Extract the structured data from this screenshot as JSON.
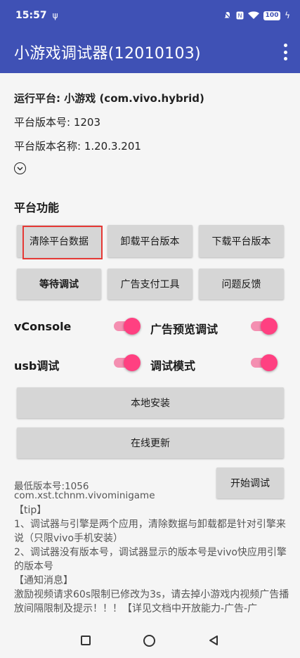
{
  "status_bar": {
    "time": "15:57",
    "battery": "100"
  },
  "app_bar": {
    "title": "小游戏调试器(12010103)"
  },
  "info": {
    "platform_label": "运行平台: 小游戏 (com.vivo.hybrid)",
    "version_code": "平台版本号: 1203",
    "version_name": "平台版本名称: 1.20.3.201"
  },
  "platform_features": {
    "title": "平台功能",
    "buttons": [
      {
        "label": "清除平台数据"
      },
      {
        "label": "卸载平台版本"
      },
      {
        "label": "下载平台版本"
      },
      {
        "label": "等待调试"
      },
      {
        "label": "广告支付工具"
      },
      {
        "label": "问题反馈"
      }
    ]
  },
  "toggles": [
    {
      "label": "vConsole",
      "on": true
    },
    {
      "label": "广告预览调试",
      "on": true
    },
    {
      "label": "usb调试",
      "on": true
    },
    {
      "label": "调试模式",
      "on": true
    }
  ],
  "actions": {
    "local_install": "本地安装",
    "online_update": "在线更新",
    "start_debug": "开始调试"
  },
  "min_version": "最低版本号:1056",
  "package_name": "com.xst.tchnm.vivominigame",
  "notes": [
    "【tip】",
    "1、调试器与引擎是两个应用，清除数据与卸载都是针对引擎来说（只限vivo手机安装）",
    "2、调试器没有版本号，调试器显示的版本号是vivo快应用引擎的版本号",
    "【通知消息】",
    "激励视频请求60s限制已修改为3s，请去掉小游戏内视频广告播放间隔限制及提示！！！【详见文档中开放能力-广告-广"
  ],
  "colors": {
    "primary": "#3f51b5",
    "accent": "#ff4081",
    "highlight": "#e53935"
  }
}
